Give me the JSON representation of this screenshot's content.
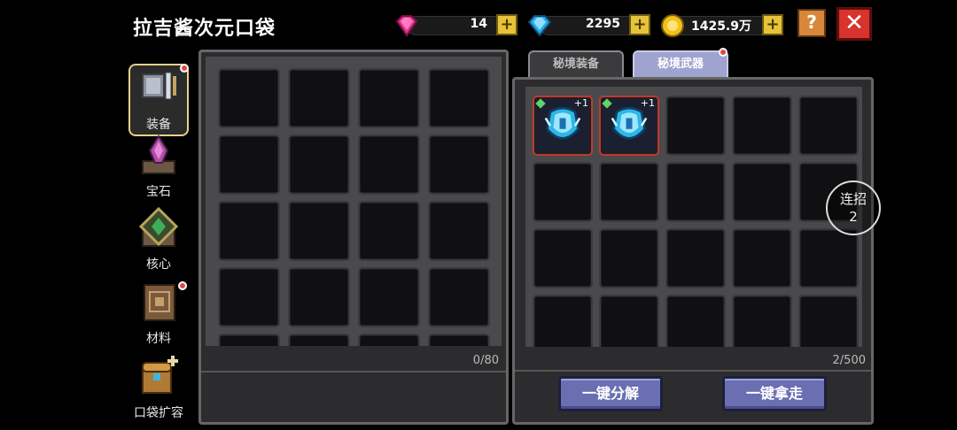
{
  "header": {
    "title": "拉吉酱次元口袋",
    "currencies": [
      {
        "icon": "pink-gem-icon",
        "value": "14"
      },
      {
        "icon": "blue-diamond-icon",
        "value": "2295"
      },
      {
        "icon": "gold-coin-icon",
        "value": "1425.9万"
      }
    ],
    "help_label": "?",
    "close_label": "✕"
  },
  "sidebar": {
    "items": [
      {
        "label": "装备",
        "icon": "armor-icon",
        "active": true,
        "dot": true
      },
      {
        "label": "宝石",
        "icon": "gem-crystal-icon",
        "active": false,
        "dot": false
      },
      {
        "label": "核心",
        "icon": "core-icon",
        "active": false,
        "dot": false
      },
      {
        "label": "材料",
        "icon": "material-book-icon",
        "active": false,
        "dot": true
      },
      {
        "label": "口袋扩容",
        "icon": "chest-expand-icon",
        "active": false,
        "dot": false
      }
    ]
  },
  "left_panel": {
    "count": "0/80"
  },
  "right_panel": {
    "tabs": [
      {
        "label": "秘境装备",
        "active": false
      },
      {
        "label": "秘境武器",
        "active": true,
        "dot": true
      }
    ],
    "items": [
      {
        "level": "+1",
        "icon": "crystal-weapon-icon"
      },
      {
        "level": "+1",
        "icon": "crystal-weapon-icon"
      }
    ],
    "count": "2/500",
    "buttons": {
      "decompose": "一键分解",
      "take_all": "一键拿走"
    }
  },
  "combo": {
    "label": "连招",
    "value": "2"
  }
}
